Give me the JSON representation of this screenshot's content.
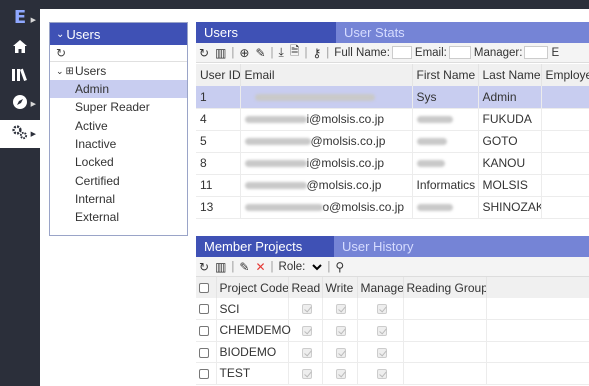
{
  "rail": {
    "logo": "E",
    "items": [
      {
        "name": "home-icon",
        "glyph": "⌂"
      },
      {
        "name": "library-icon",
        "glyph": "⫼"
      },
      {
        "name": "compass-icon",
        "glyph": "◈"
      },
      {
        "name": "admin-gear-icon",
        "glyph": "⚙"
      }
    ]
  },
  "users_panel": {
    "title": "Users",
    "tree_root": "Users",
    "items": [
      "Admin",
      "Super Reader",
      "Active",
      "Inactive",
      "Locked",
      "Certified",
      "Internal",
      "External"
    ],
    "selected": "Admin"
  },
  "users_tabs": {
    "active": "Users",
    "inactive": "User Stats"
  },
  "users_toolbar": {
    "full_name_label": "Full Name:",
    "email_label": "Email:",
    "manager_label": "Manager:",
    "trailing_letter": "E"
  },
  "users_table": {
    "columns": [
      "User ID",
      "Email",
      "First Name",
      "Last Name",
      "Employee"
    ],
    "rows": [
      {
        "id": "1",
        "email_suffix": "",
        "first": "Sys",
        "last": "Admin"
      },
      {
        "id": "4",
        "email_suffix": "i@molsis.co.jp",
        "first": "",
        "last": "FUKUDA"
      },
      {
        "id": "5",
        "email_suffix": "@molsis.co.jp",
        "first": "",
        "last": "GOTO"
      },
      {
        "id": "8",
        "email_suffix": "i@molsis.co.jp",
        "first": "",
        "last": "KANOU"
      },
      {
        "id": "11",
        "email_suffix": "@molsis.co.jp",
        "first": "Informatics",
        "last": "MOLSIS"
      },
      {
        "id": "13",
        "email_suffix": "o@molsis.co.jp",
        "first": "",
        "last": "SHINOZAKI"
      }
    ]
  },
  "mp_tabs": {
    "active": "Member Projects",
    "inactive": "User History"
  },
  "mp_toolbar": {
    "role_label": "Role:"
  },
  "mp_table": {
    "columns": [
      "Project Code",
      "Read",
      "Write",
      "Manage",
      "Reading Group"
    ],
    "rows": [
      {
        "code": "SCI"
      },
      {
        "code": "CHEMDEMO"
      },
      {
        "code": "BIODEMO"
      },
      {
        "code": "TEST"
      }
    ]
  }
}
